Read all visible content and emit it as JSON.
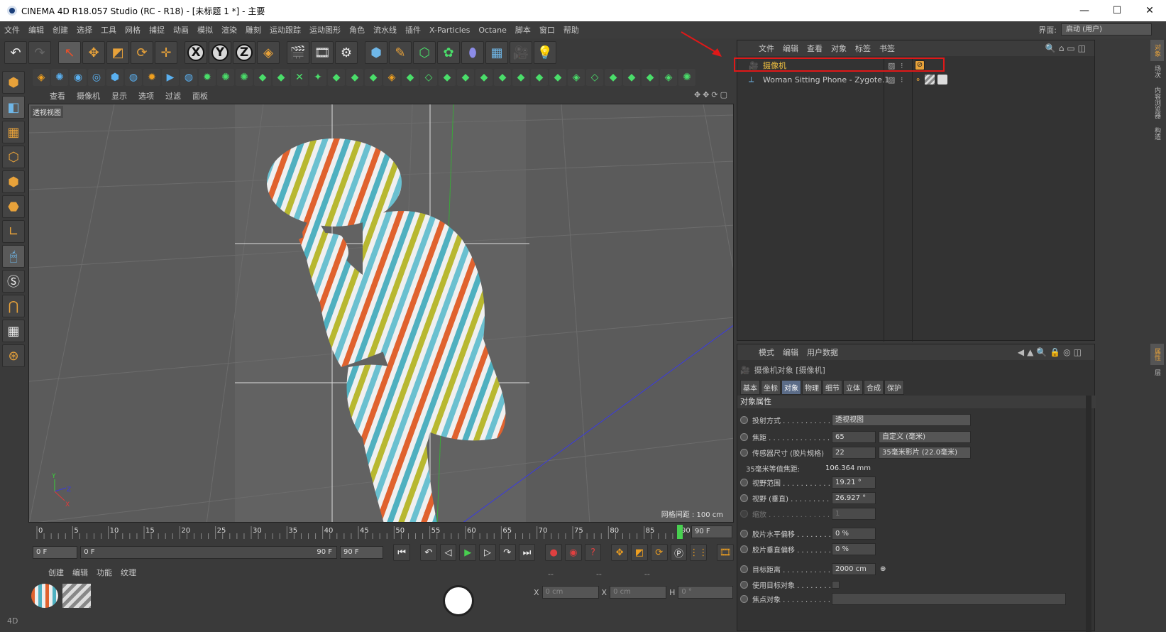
{
  "window": {
    "title": "CINEMA 4D R18.057 Studio (RC - R18) - [未标题 1 *] - 主要",
    "controls": [
      "—",
      "☐",
      "✕"
    ]
  },
  "menu": [
    "文件",
    "编辑",
    "创建",
    "选择",
    "工具",
    "网格",
    "捕捉",
    "动画",
    "模拟",
    "渲染",
    "雕刻",
    "运动跟踪",
    "运动图形",
    "角色",
    "流水线",
    "插件",
    "X-Particles",
    "Octane",
    "脚本",
    "窗口",
    "帮助"
  ],
  "layout": {
    "label": "界面:",
    "value": "启动 (用户)"
  },
  "viewport": {
    "menu": [
      "查看",
      "摄像机",
      "显示",
      "选项",
      "过滤",
      "面板"
    ],
    "label": "透视视图",
    "grid_info": "网格间距 : 100 cm"
  },
  "timeline": {
    "ticks": [
      "0",
      "5",
      "10",
      "15",
      "20",
      "25",
      "30",
      "35",
      "40",
      "45",
      "50",
      "55",
      "60",
      "65",
      "70",
      "75",
      "80",
      "85",
      "90"
    ],
    "end_field": "90 F",
    "current_frame": 90
  },
  "controls": {
    "start": "0 F",
    "range_start": "0 F",
    "range_end": "90 F",
    "end": "90 F"
  },
  "materials": {
    "menu": [
      "创建",
      "编辑",
      "功能",
      "纹理"
    ]
  },
  "coords": {
    "dash1": "--",
    "dash2": "--",
    "dash3": "--",
    "x_label": "X",
    "x_val": "0 cm",
    "x2_label": "X",
    "x2_val": "0 cm",
    "h_label": "H",
    "h_val": "0 °"
  },
  "objects": {
    "menu": [
      "文件",
      "编辑",
      "查看",
      "对象",
      "标签",
      "书签"
    ],
    "rows": [
      {
        "name": "摄像机",
        "color": "#f0c040"
      },
      {
        "name": "Woman Sitting Phone - Zygote.1",
        "color": "#c9c9c9"
      }
    ]
  },
  "attributes": {
    "menu": [
      "模式",
      "编辑",
      "用户数据"
    ],
    "title": "摄像机对象 [摄像机]",
    "tabs": [
      "基本",
      "坐标",
      "对象",
      "物理",
      "细节",
      "立体",
      "合成",
      "保护"
    ],
    "active_tab": "对象",
    "section": "对象属性",
    "props": [
      {
        "label": "投射方式 . . . . . . . . . . . .",
        "value": "透视视图",
        "type": "drop"
      },
      {
        "label": "焦距 . . . . . . . . . . . . . . .",
        "value": "65",
        "drop": "自定义 (毫米)"
      },
      {
        "label": "传感器尺寸 (胶片规格)",
        "value": "22",
        "drop": "35毫米影片 (22.0毫米)"
      },
      {
        "label": "35毫米等值焦距:",
        "value": "106.364 mm",
        "type": "text"
      },
      {
        "label": "视野范围 . . . . . . . . . . . .",
        "value": "19.21 °"
      },
      {
        "label": "视野 (垂直) . . . . . . . . . .",
        "value": "26.927 °"
      },
      {
        "label": "缩放 . . . . . . . . . . . . . . .",
        "value": "1",
        "disabled": true
      },
      {
        "label": "胶片水平偏移 . . . . . . . .",
        "value": "0 %"
      },
      {
        "label": "胶片垂直偏移 . . . . . . . .",
        "value": "0 %"
      },
      {
        "label": "目标距离 . . . . . . . . . . . .",
        "value": "2000 cm"
      },
      {
        "label": "使用目标对象 . . . . . . . .",
        "value": "",
        "type": "check"
      },
      {
        "label": "焦点对象 . . . . . . . . . . . .",
        "value": "",
        "type": "field"
      }
    ]
  },
  "side_tabs": [
    "对象",
    "场次",
    "内容浏览器",
    "构造"
  ],
  "side_tabs2": [
    "属性",
    "层"
  ],
  "left_label": "4D"
}
